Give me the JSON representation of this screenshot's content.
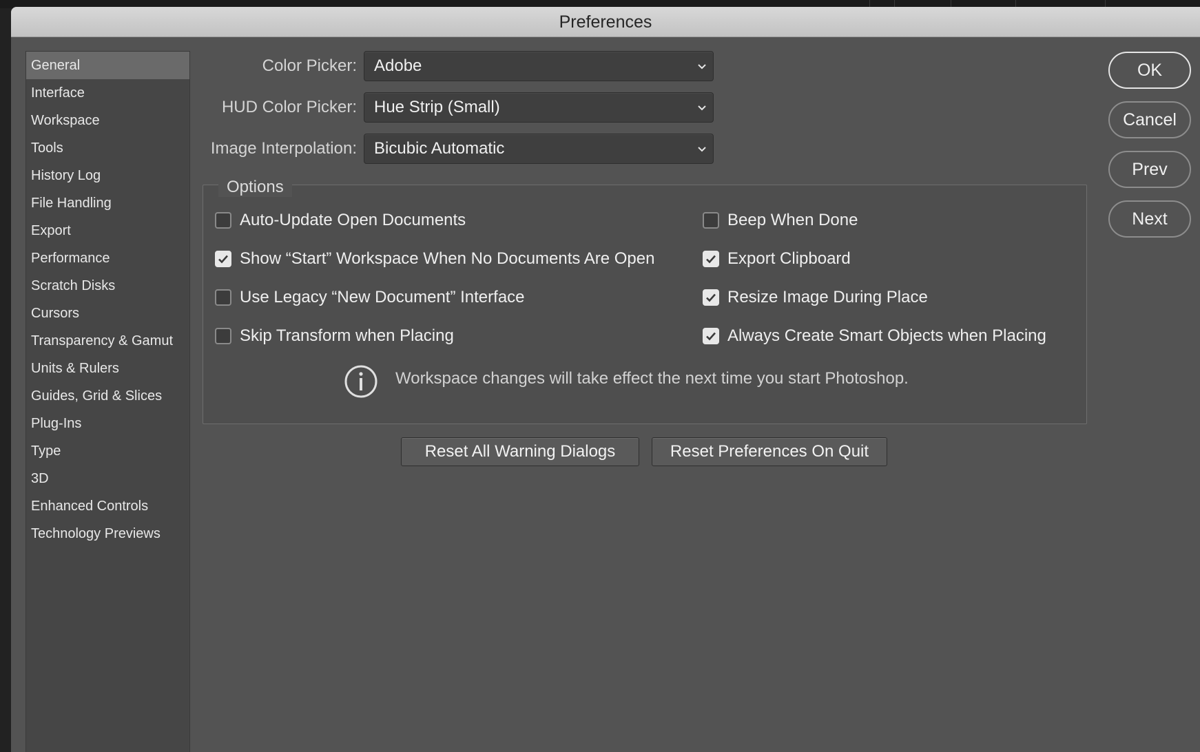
{
  "window": {
    "title": "Preferences"
  },
  "sidebar": {
    "items": [
      {
        "label": "General",
        "selected": true
      },
      {
        "label": "Interface"
      },
      {
        "label": "Workspace"
      },
      {
        "label": "Tools"
      },
      {
        "label": "History Log"
      },
      {
        "label": "File Handling"
      },
      {
        "label": "Export"
      },
      {
        "label": "Performance"
      },
      {
        "label": "Scratch Disks"
      },
      {
        "label": "Cursors"
      },
      {
        "label": "Transparency & Gamut"
      },
      {
        "label": "Units & Rulers"
      },
      {
        "label": "Guides, Grid & Slices"
      },
      {
        "label": "Plug-Ins"
      },
      {
        "label": "Type"
      },
      {
        "label": "3D"
      },
      {
        "label": "Enhanced Controls"
      },
      {
        "label": "Technology Previews"
      }
    ]
  },
  "fields": {
    "color_picker": {
      "label": "Color Picker:",
      "value": "Adobe"
    },
    "hud_color_picker": {
      "label": "HUD Color Picker:",
      "value": "Hue Strip (Small)"
    },
    "image_interpolation": {
      "label": "Image Interpolation:",
      "value": "Bicubic Automatic"
    }
  },
  "options": {
    "legend": "Options",
    "left": [
      {
        "label": "Auto-Update Open Documents",
        "checked": false
      },
      {
        "label": "Show “Start” Workspace When No Documents Are Open",
        "checked": true
      },
      {
        "label": "Use Legacy “New Document” Interface",
        "checked": false
      },
      {
        "label": "Skip Transform when Placing",
        "checked": false
      }
    ],
    "right": [
      {
        "label": "Beep When Done",
        "checked": false
      },
      {
        "label": "Export Clipboard",
        "checked": true
      },
      {
        "label": "Resize Image During Place",
        "checked": true
      },
      {
        "label": "Always Create Smart Objects when Placing",
        "checked": true
      }
    ],
    "info_icon": "info-circle-icon",
    "info_text": "Workspace changes will take effect the next time you start Photoshop."
  },
  "reset_buttons": {
    "warnings": "Reset All Warning Dialogs",
    "prefs_on_quit": "Reset Preferences On Quit"
  },
  "dialog_buttons": {
    "ok": "OK",
    "cancel": "Cancel",
    "prev": "Prev",
    "next": "Next"
  },
  "colors": {
    "dialog_bg": "#535353",
    "sidebar_bg": "#464646",
    "selected_bg": "#6a6a6a",
    "titlebar_bg": "#cfcfcf"
  }
}
